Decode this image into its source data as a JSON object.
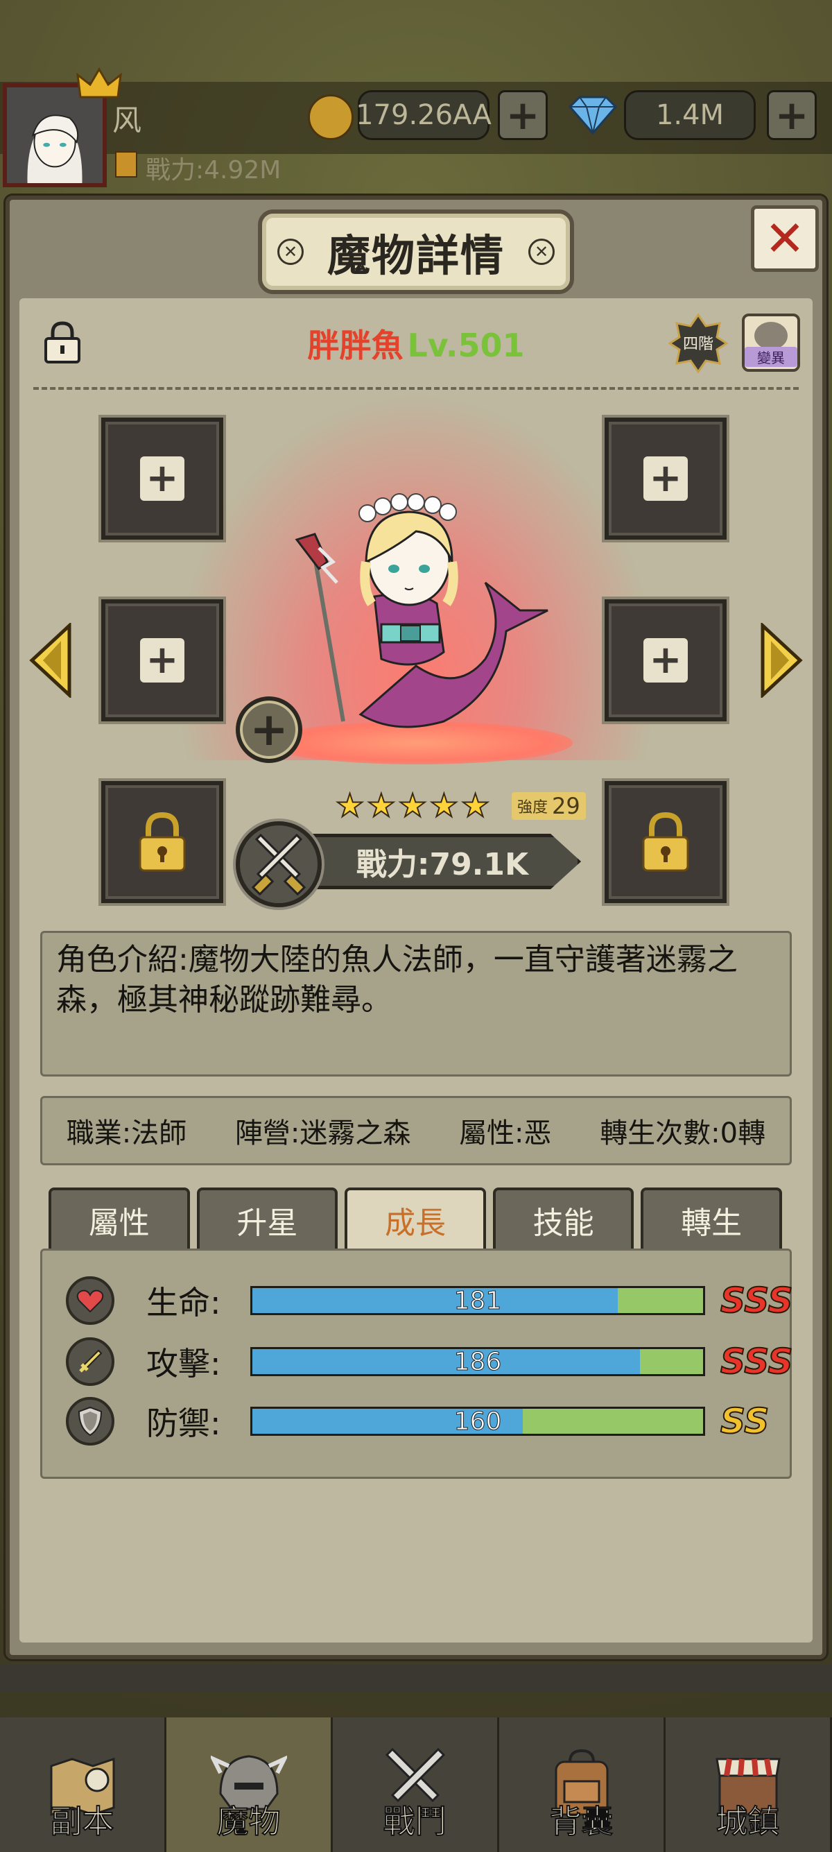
{
  "player": {
    "name": "风",
    "power": "戰力:4.92M",
    "gold": "179.26AA",
    "diamonds": "1.4M"
  },
  "dialog": {
    "title": "魔物詳情",
    "monster_name": "胖胖魚",
    "monster_level": "Lv.501",
    "rank_badge": "四階",
    "mutation_badge": "變異",
    "stars": 5,
    "strength_label": "強度",
    "strength_value": "29",
    "power": "戰力:79.1K",
    "description": "角色介紹:魔物大陸的魚人法師，一直守護著迷霧之森，極其神秘蹤跡難尋。",
    "info": {
      "job": "職業:法師",
      "faction": "陣營:迷霧之森",
      "attribute": "屬性:恶",
      "rebirth": "轉生次數:0轉"
    },
    "tabs": [
      "屬性",
      "升星",
      "成長",
      "技能",
      "轉生"
    ],
    "active_tab": "成長",
    "stats": [
      {
        "label": "生命:",
        "value": "181",
        "fill": 0.81,
        "grade": "SSS",
        "icon": "heart-icon"
      },
      {
        "label": "攻擊:",
        "value": "186",
        "fill": 0.86,
        "grade": "SSS",
        "icon": "sword-icon"
      },
      {
        "label": "防禦:",
        "value": "160",
        "fill": 0.6,
        "grade": "SS",
        "icon": "shield-icon"
      }
    ]
  },
  "nav": [
    "副本",
    "魔物",
    "戰鬥",
    "背囊",
    "城鎮"
  ],
  "colors": {
    "grade_sss": "#e8352a",
    "grade_ss": "#f2c12e",
    "bar_fill": "#4fa6d8",
    "bar_track": "#96c867"
  }
}
